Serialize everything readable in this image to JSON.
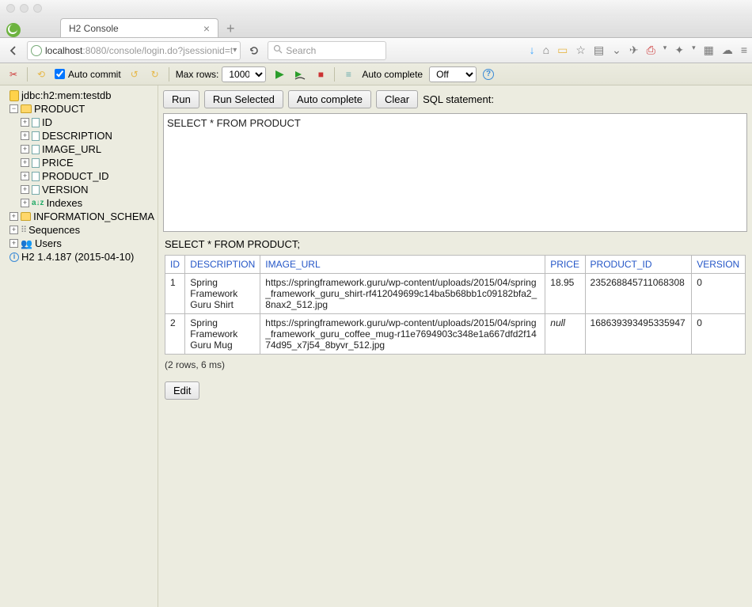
{
  "browser": {
    "tab_title": "H2 Console",
    "url_host": "localhost",
    "url_port": ":8080",
    "url_path": "/console/login.do?jsessionid=t",
    "search_placeholder": "Search"
  },
  "h2bar": {
    "auto_commit": "Auto commit",
    "max_rows_label": "Max rows:",
    "max_rows_value": "1000",
    "auto_complete_label": "Auto complete",
    "auto_complete_value": "Off"
  },
  "sidebar": {
    "db": "jdbc:h2:mem:testdb",
    "table": "PRODUCT",
    "columns": [
      "ID",
      "DESCRIPTION",
      "IMAGE_URL",
      "PRICE",
      "PRODUCT_ID",
      "VERSION"
    ],
    "indexes": "Indexes",
    "info_schema": "INFORMATION_SCHEMA",
    "sequences": "Sequences",
    "users": "Users",
    "version": "H2 1.4.187 (2015-04-10)"
  },
  "cmd": {
    "run": "Run",
    "run_selected": "Run Selected",
    "auto_complete": "Auto complete",
    "clear": "Clear",
    "sql_statement": "SQL statement:"
  },
  "sql": "SELECT * FROM PRODUCT",
  "results": {
    "statement": "SELECT * FROM PRODUCT;",
    "headers": [
      "ID",
      "DESCRIPTION",
      "IMAGE_URL",
      "PRICE",
      "PRODUCT_ID",
      "VERSION"
    ],
    "rows": [
      {
        "id": "1",
        "desc": "Spring Framework Guru Shirt",
        "img": "https://springframework.guru/wp-content/uploads/2015/04/spring_framework_guru_shirt-rf412049699c14ba5b68bb1c09182bfa2_8nax2_512.jpg",
        "price": "18.95",
        "pid": "235268845711068308",
        "ver": "0"
      },
      {
        "id": "2",
        "desc": "Spring Framework Guru Mug",
        "img": "https://springframework.guru/wp-content/uploads/2015/04/spring_framework_guru_coffee_mug-r11e7694903c348e1a667dfd2f1474d95_x7j54_8byvr_512.jpg",
        "price": "null",
        "pid": "168639393495335947",
        "ver": "0"
      }
    ],
    "summary": "(2 rows, 6 ms)",
    "edit": "Edit"
  }
}
